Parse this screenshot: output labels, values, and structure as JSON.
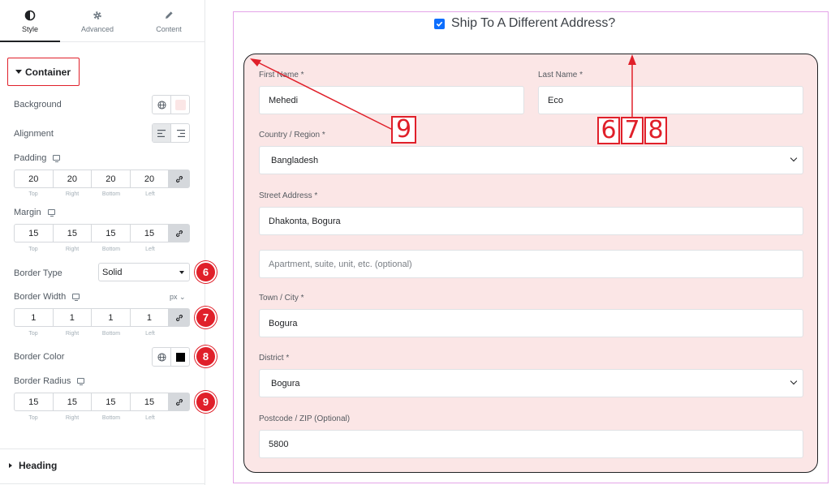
{
  "panel": {
    "tabs": [
      {
        "label": "Style",
        "icon": "contrast-circle-icon"
      },
      {
        "label": "Advanced",
        "icon": "gear-icon"
      },
      {
        "label": "Content",
        "icon": "pencil-icon"
      }
    ],
    "section_title": "Container",
    "background_label": "Background",
    "alignment_label": "Alignment",
    "padding": {
      "label": "Padding",
      "values": [
        "20",
        "20",
        "20",
        "20"
      ]
    },
    "margin": {
      "label": "Margin",
      "values": [
        "15",
        "15",
        "15",
        "15"
      ]
    },
    "dimension_labels": [
      "Top",
      "Right",
      "Bottom",
      "Left"
    ],
    "border_type": {
      "label": "Border Type",
      "value": "Solid"
    },
    "border_width": {
      "label": "Border Width",
      "unit": "px",
      "values": [
        "1",
        "1",
        "1",
        "1"
      ]
    },
    "border_color_label": "Border Color",
    "border_radius": {
      "label": "Border Radius",
      "values": [
        "15",
        "15",
        "15",
        "15"
      ]
    },
    "heading_section": "Heading",
    "badges": [
      "6",
      "7",
      "8",
      "9"
    ]
  },
  "preview": {
    "ship_label": "Ship To A Different Address?",
    "ship_checked": true,
    "first_name": {
      "label": "First Name *",
      "value": "Mehedi"
    },
    "last_name": {
      "label": "Last Name *",
      "value": "Eco"
    },
    "country": {
      "label": "Country / Region *",
      "value": "Bangladesh"
    },
    "street": {
      "label": "Street Address *",
      "value": "Dhakonta, Bogura"
    },
    "apartment": {
      "placeholder": "Apartment, suite, unit, etc. (optional)"
    },
    "town": {
      "label": "Town / City *",
      "value": "Bogura"
    },
    "district": {
      "label": "District *",
      "value": "Bogura"
    },
    "postcode": {
      "label": "Postcode / ZIP (Optional)",
      "value": "5800"
    }
  },
  "annotations": {
    "left_box": "9",
    "right_boxes": [
      "6",
      "7",
      "8"
    ]
  },
  "colors": {
    "accent_red": "#e0202a",
    "form_background": "#fbe6e6",
    "checkbox_blue": "#0d6efd"
  }
}
